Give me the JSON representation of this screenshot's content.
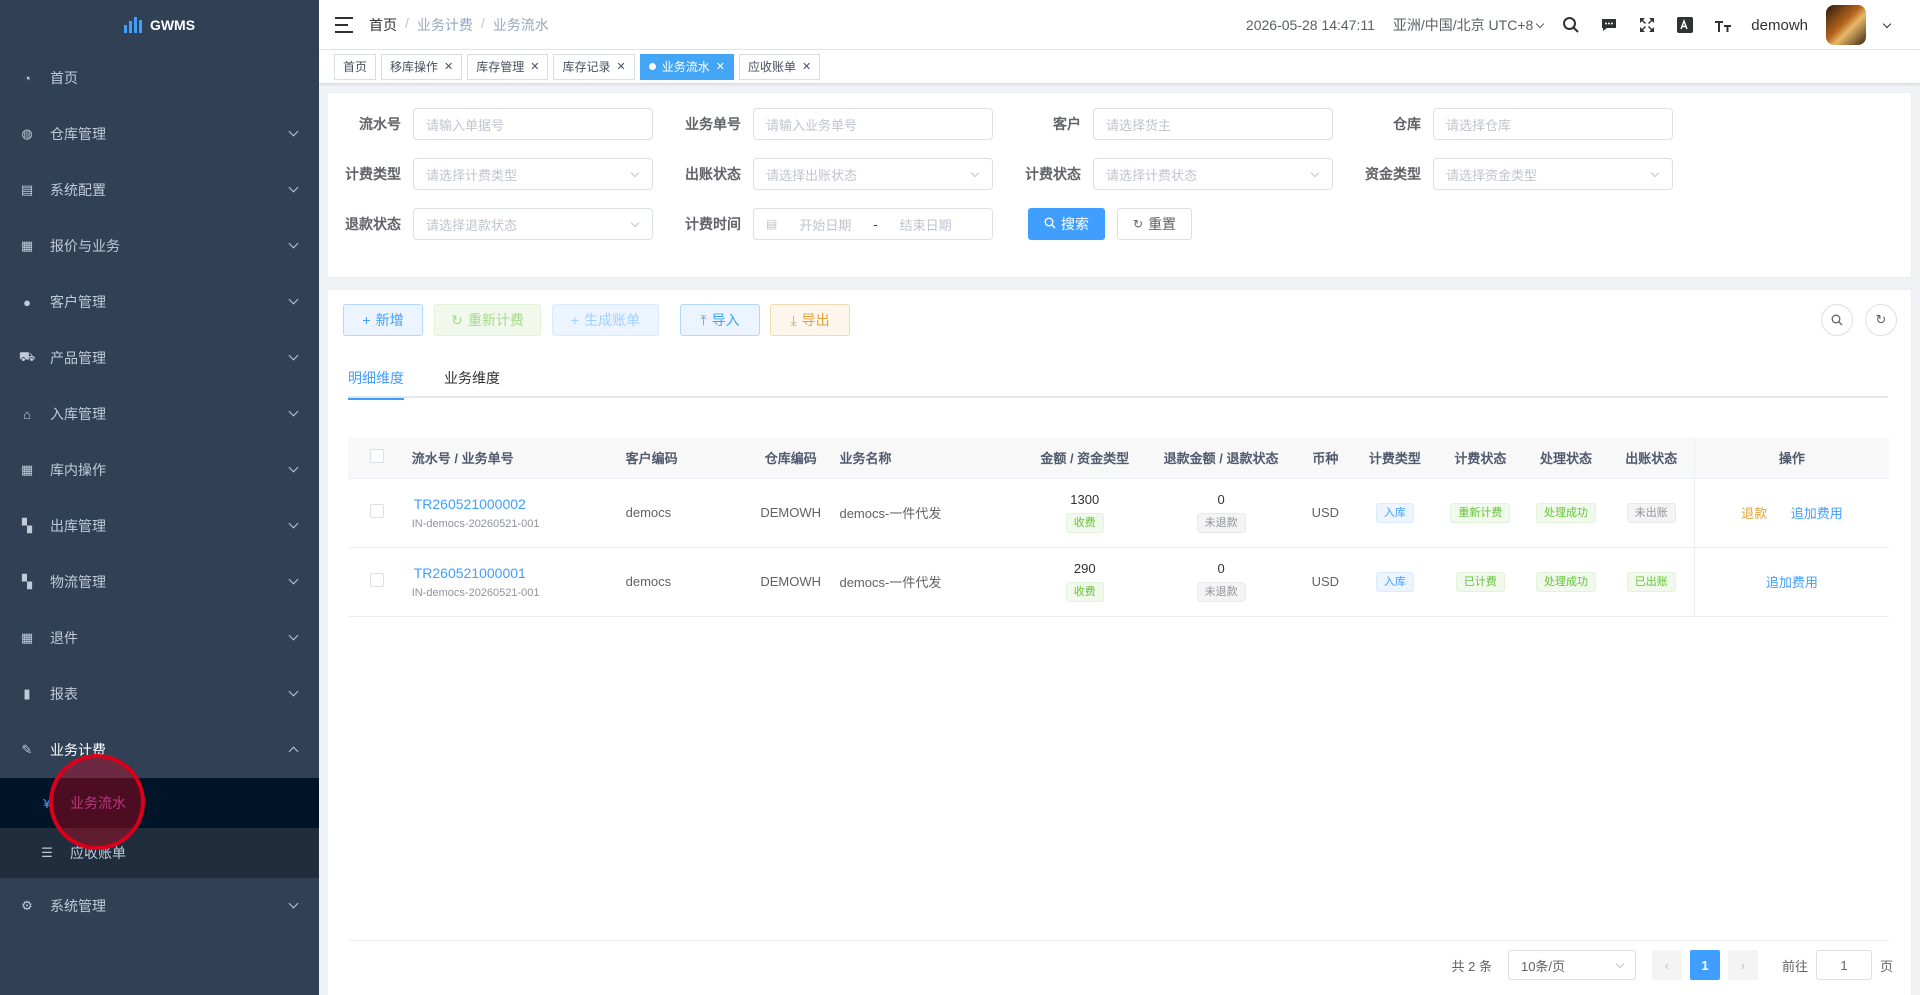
{
  "app": {
    "logo_text": "GWMS"
  },
  "sidebar": {
    "items": [
      {
        "label": "首页",
        "icon": "dashboard-icon"
      },
      {
        "label": "仓库管理",
        "icon": "globe-icon"
      },
      {
        "label": "系统配置",
        "icon": "server-icon"
      },
      {
        "label": "报价与业务",
        "icon": "form-icon"
      },
      {
        "label": "客户管理",
        "icon": "user-icon"
      },
      {
        "label": "产品管理",
        "icon": "cart-icon"
      },
      {
        "label": "入库管理",
        "icon": "home-icon"
      },
      {
        "label": "库内操作",
        "icon": "table-icon"
      },
      {
        "label": "出库管理",
        "icon": "grid-icon"
      },
      {
        "label": "物流管理",
        "icon": "grid-icon"
      },
      {
        "label": "退件",
        "icon": "form-icon"
      },
      {
        "label": "报表",
        "icon": "chart-icon"
      },
      {
        "label": "业务计费",
        "icon": "edit-icon"
      },
      {
        "label": "系统管理",
        "icon": "gear-icon"
      }
    ],
    "sub_items": [
      {
        "label": "业务流水",
        "icon": "yen-icon"
      },
      {
        "label": "应收账单",
        "icon": "list-icon"
      }
    ]
  },
  "header": {
    "breadcrumb": [
      "首页",
      "业务计费",
      "业务流水"
    ],
    "datetime": "2026-05-28 14:47:11",
    "timezone": "亚洲/中国/北京 UTC+8",
    "username": "demowh"
  },
  "tags": [
    {
      "label": "首页",
      "closable": false,
      "active": false
    },
    {
      "label": "移库操作",
      "closable": true,
      "active": false
    },
    {
      "label": "库存管理",
      "closable": true,
      "active": false
    },
    {
      "label": "库存记录",
      "closable": true,
      "active": false
    },
    {
      "label": "业务流水",
      "closable": true,
      "active": true
    },
    {
      "label": "应收账单",
      "closable": true,
      "active": false
    }
  ],
  "filters": {
    "serial_no": {
      "label": "流水号",
      "placeholder": "请输入单据号"
    },
    "biz_no": {
      "label": "业务单号",
      "placeholder": "请输入业务单号"
    },
    "customer": {
      "label": "客户",
      "placeholder": "请选择货主"
    },
    "warehouse": {
      "label": "仓库",
      "placeholder": "请选择仓库"
    },
    "charge_type": {
      "label": "计费类型",
      "placeholder": "请选择计费类型"
    },
    "bill_status": {
      "label": "出账状态",
      "placeholder": "请选择出账状态"
    },
    "charge_status": {
      "label": "计费状态",
      "placeholder": "请选择计费状态"
    },
    "fund_type": {
      "label": "资金类型",
      "placeholder": "请选择资金类型"
    },
    "refund_status": {
      "label": "退款状态",
      "placeholder": "请选择退款状态"
    },
    "charge_time": {
      "label": "计费时间",
      "start_placeholder": "开始日期",
      "end_placeholder": "结束日期",
      "range_sep": "-"
    },
    "search_label": "搜索",
    "reset_label": "重置"
  },
  "toolbar": {
    "add": "新增",
    "recharge": "重新计费",
    "gen_bill": "生成账单",
    "import": "导入",
    "export": "导出"
  },
  "tabs": [
    "明细维度",
    "业务维度"
  ],
  "table": {
    "headers": [
      "流水号 / 业务单号",
      "客户编码",
      "仓库编码",
      "业务名称",
      "金额 / 资金类型",
      "退款金额 / 退款状态",
      "币种",
      "计费类型",
      "计费状态",
      "处理状态",
      "出账状态",
      "操作"
    ],
    "rows": [
      {
        "serial": "TR260521000002",
        "biz_no": "IN-democs-20260521-001",
        "customer_code": "democs",
        "warehouse_code": "DEMOWH",
        "biz_name": "democs-一件代发",
        "amount": "1300",
        "fund_type": "收费",
        "refund_amount": "0",
        "refund_status": "未退款",
        "currency": "USD",
        "charge_type": "入库",
        "charge_status": "重新计费",
        "process_status": "处理成功",
        "bill_status": "未出账",
        "actions": [
          "退款",
          "追加费用"
        ]
      },
      {
        "serial": "TR260521000001",
        "biz_no": "IN-democs-20260521-001",
        "customer_code": "democs",
        "warehouse_code": "DEMOWH",
        "biz_name": "democs-一件代发",
        "amount": "290",
        "fund_type": "收费",
        "refund_amount": "0",
        "refund_status": "未退款",
        "currency": "USD",
        "charge_type": "入库",
        "charge_status": "已计费",
        "process_status": "处理成功",
        "bill_status": "已出账",
        "actions": [
          "追加费用"
        ]
      }
    ]
  },
  "pagination": {
    "total_text": "共 2 条",
    "page_size": "10条/页",
    "current_page": "1",
    "goto_label": "前往",
    "goto_value": "1",
    "page_suffix": "页"
  },
  "colors": {
    "sidebar_bg": "#304156",
    "primary": "#409eff",
    "success": "#67c23a",
    "warning": "#e6a23c"
  }
}
